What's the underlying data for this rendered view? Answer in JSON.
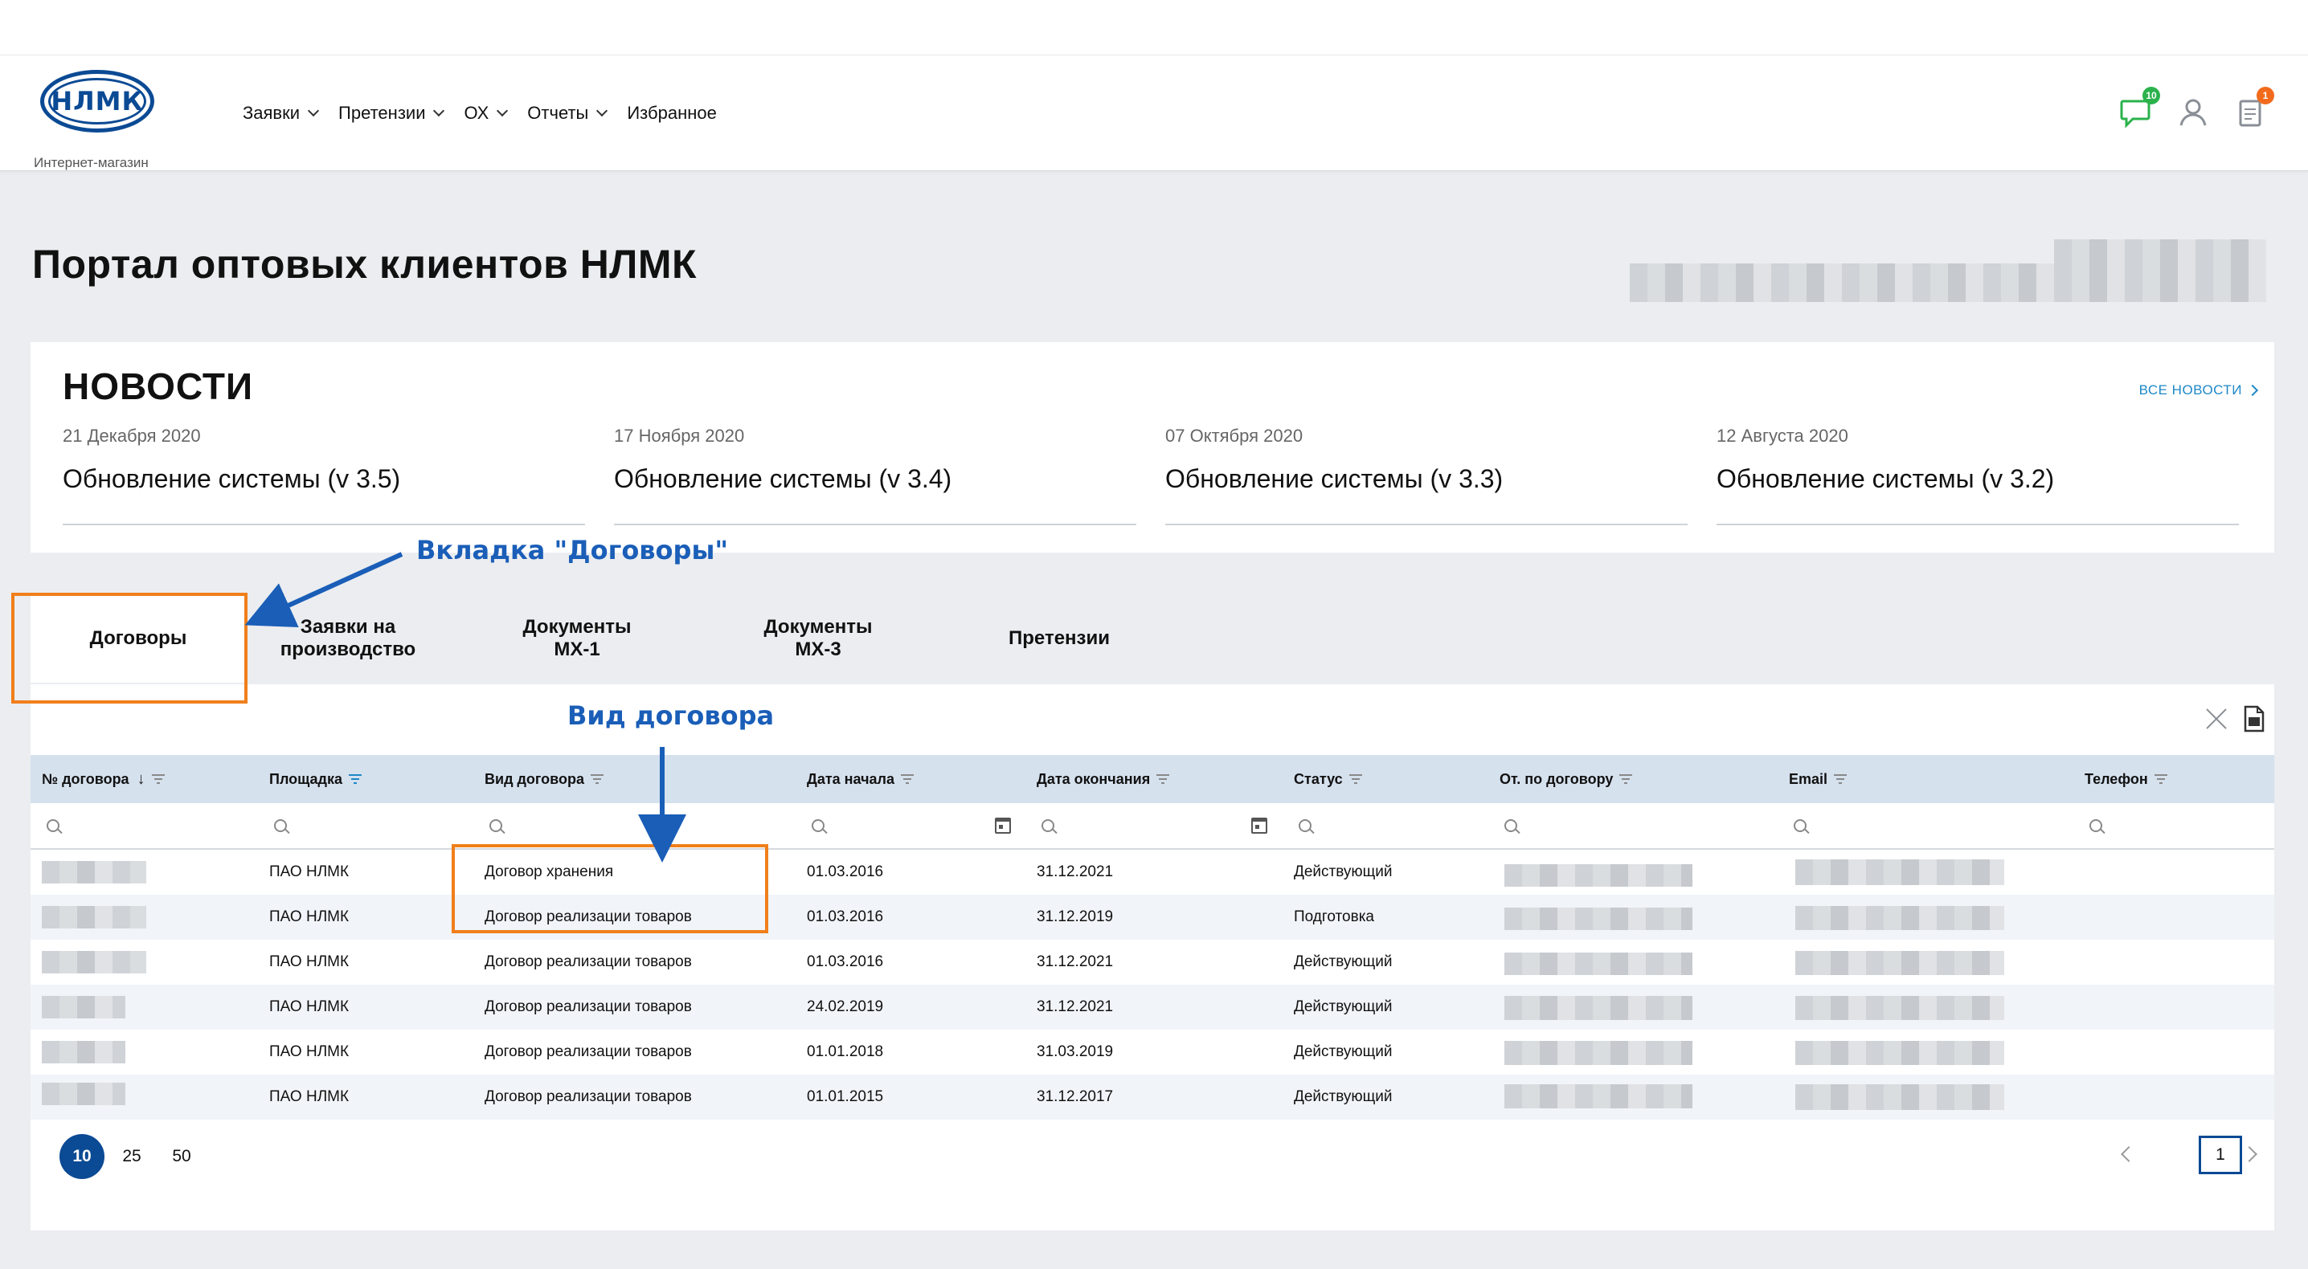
{
  "header": {
    "logo_text": "НЛМК",
    "logo_caption": "Интернет-магазин",
    "nav": [
      "Заявки",
      "Претензии",
      "ОХ",
      "Отчеты",
      "Избранное"
    ],
    "messages_badge": "10",
    "cart_badge": "1",
    "colors": {
      "brand": "#0b4a94",
      "messages_badge": "#2bb24c",
      "cart_badge": "#f26b1d"
    }
  },
  "page_title": "Портал оптовых клиентов НЛМК",
  "news": {
    "title": "НОВОСТИ",
    "all_link": "ВСЕ НОВОСТИ",
    "items": [
      {
        "date": "21 Декабря 2020",
        "headline": "Обновление системы (v 3.5)"
      },
      {
        "date": "17 Ноября 2020",
        "headline": "Обновление системы (v 3.4)"
      },
      {
        "date": "07 Октября 2020",
        "headline": "Обновление системы (v 3.3)"
      },
      {
        "date": "12 Августа 2020",
        "headline": "Обновление системы (v 3.2)"
      }
    ]
  },
  "annotations": {
    "tab_note": "Вкладка \"Договоры\"",
    "column_note": "Вид договора",
    "color": "#1a5eb8",
    "highlight_color": "#f07f1b"
  },
  "tabs": [
    "Договоры",
    "Заявки на производство",
    "Документы МХ-1",
    "Документы МХ-3",
    "Претензии"
  ],
  "table": {
    "columns": [
      "№ договора",
      "Площадка",
      "Вид договора",
      "Дата начала",
      "Дата окончания",
      "Статус",
      "От. по договору",
      "Email",
      "Телефон"
    ],
    "rows": [
      [
        "",
        "ПАО НЛМК",
        "Договор хранения",
        "01.03.2016",
        "31.12.2021",
        "Действующий"
      ],
      [
        "",
        "ПАО НЛМК",
        "Договор реализации товаров",
        "01.03.2016",
        "31.12.2019",
        "Подготовка"
      ],
      [
        "",
        "ПАО НЛМК",
        "Договор реализации товаров",
        "01.03.2016",
        "31.12.2021",
        "Действующий"
      ],
      [
        "",
        "ПАО НЛМК",
        "Договор реализации товаров",
        "24.02.2019",
        "31.12.2021",
        "Действующий"
      ],
      [
        "",
        "ПАО НЛМК",
        "Договор реализации товаров",
        "01.01.2018",
        "31.03.2019",
        "Действующий"
      ],
      [
        "",
        "ПАО НЛМК",
        "Договор реализации товаров",
        "01.01.2015",
        "31.12.2017",
        "Действующий"
      ]
    ]
  },
  "pagination": {
    "page_sizes": [
      "10",
      "25",
      "50"
    ],
    "current_page": "1"
  }
}
